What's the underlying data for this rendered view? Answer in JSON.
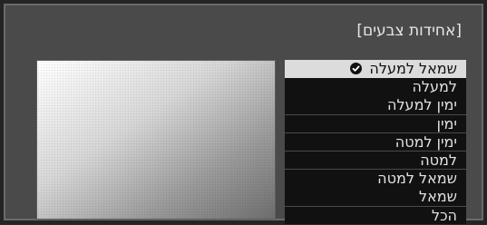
{
  "window": {
    "title": "[אחידות צבעים]"
  },
  "menu": {
    "selected_index": 0,
    "items": [
      {
        "label": "שמאל למעלה"
      },
      {
        "label": "למעלה"
      },
      {
        "label": "ימין למעלה"
      },
      {
        "label": "ימין"
      },
      {
        "label": "ימין למטה"
      },
      {
        "label": "למטה"
      },
      {
        "label": "שמאל למטה"
      },
      {
        "label": "שמאל"
      },
      {
        "label": "הכל"
      }
    ]
  },
  "icons": {
    "selected_marker": "check-circle-icon"
  },
  "colors": {
    "panel_bg": "#4a4a4a",
    "item_bg": "#111111",
    "item_text": "#e2e2e2",
    "selected_bg": "#dcdcdc",
    "selected_text": "#111111"
  }
}
